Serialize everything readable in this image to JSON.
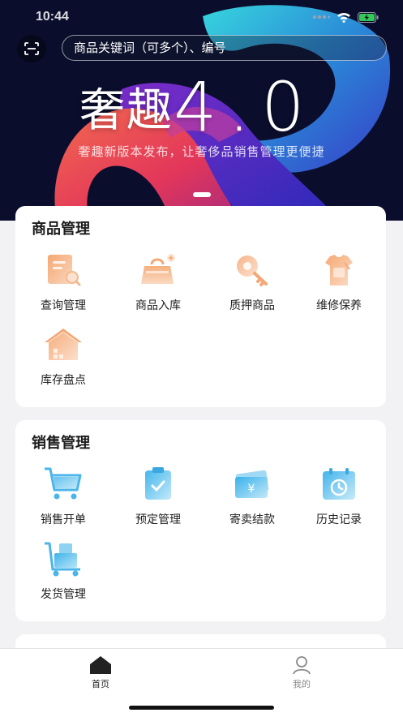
{
  "status": {
    "time": "10:44"
  },
  "search": {
    "placeholder": "商品关键词（可多个）、编号"
  },
  "banner": {
    "title_cn": "奢趣",
    "title_ver": "4.0",
    "subtitle": "奢趣新版本发布，让奢侈品销售管理更便捷"
  },
  "goods": {
    "title": "商品管理",
    "items": [
      {
        "label": "查询管理",
        "icon": "document-search-icon"
      },
      {
        "label": "商品入库",
        "icon": "handbag-add-icon"
      },
      {
        "label": "质押商品",
        "icon": "key-icon"
      },
      {
        "label": "维修保养",
        "icon": "tshirt-repair-icon"
      },
      {
        "label": "库存盘点",
        "icon": "warehouse-icon"
      }
    ]
  },
  "sales": {
    "title": "销售管理",
    "items": [
      {
        "label": "销售开单",
        "icon": "shopping-cart-icon"
      },
      {
        "label": "预定管理",
        "icon": "clipboard-check-icon"
      },
      {
        "label": "寄卖结款",
        "icon": "yuan-card-icon"
      },
      {
        "label": "历史记录",
        "icon": "calendar-history-icon"
      },
      {
        "label": "发货管理",
        "icon": "cart-boxes-icon"
      }
    ]
  },
  "tabs": [
    {
      "label": "首页",
      "icon": "home-icon",
      "active": true
    },
    {
      "label": "我的",
      "icon": "person-icon",
      "active": false
    }
  ],
  "colors": {
    "goods_icon_gradient": [
      "#f6b684",
      "#f9d9c0"
    ],
    "sales_icon_gradient": [
      "#48b7ea",
      "#a7def5"
    ],
    "tab_active": "#222222",
    "tab_inactive": "#8a8a8a"
  }
}
